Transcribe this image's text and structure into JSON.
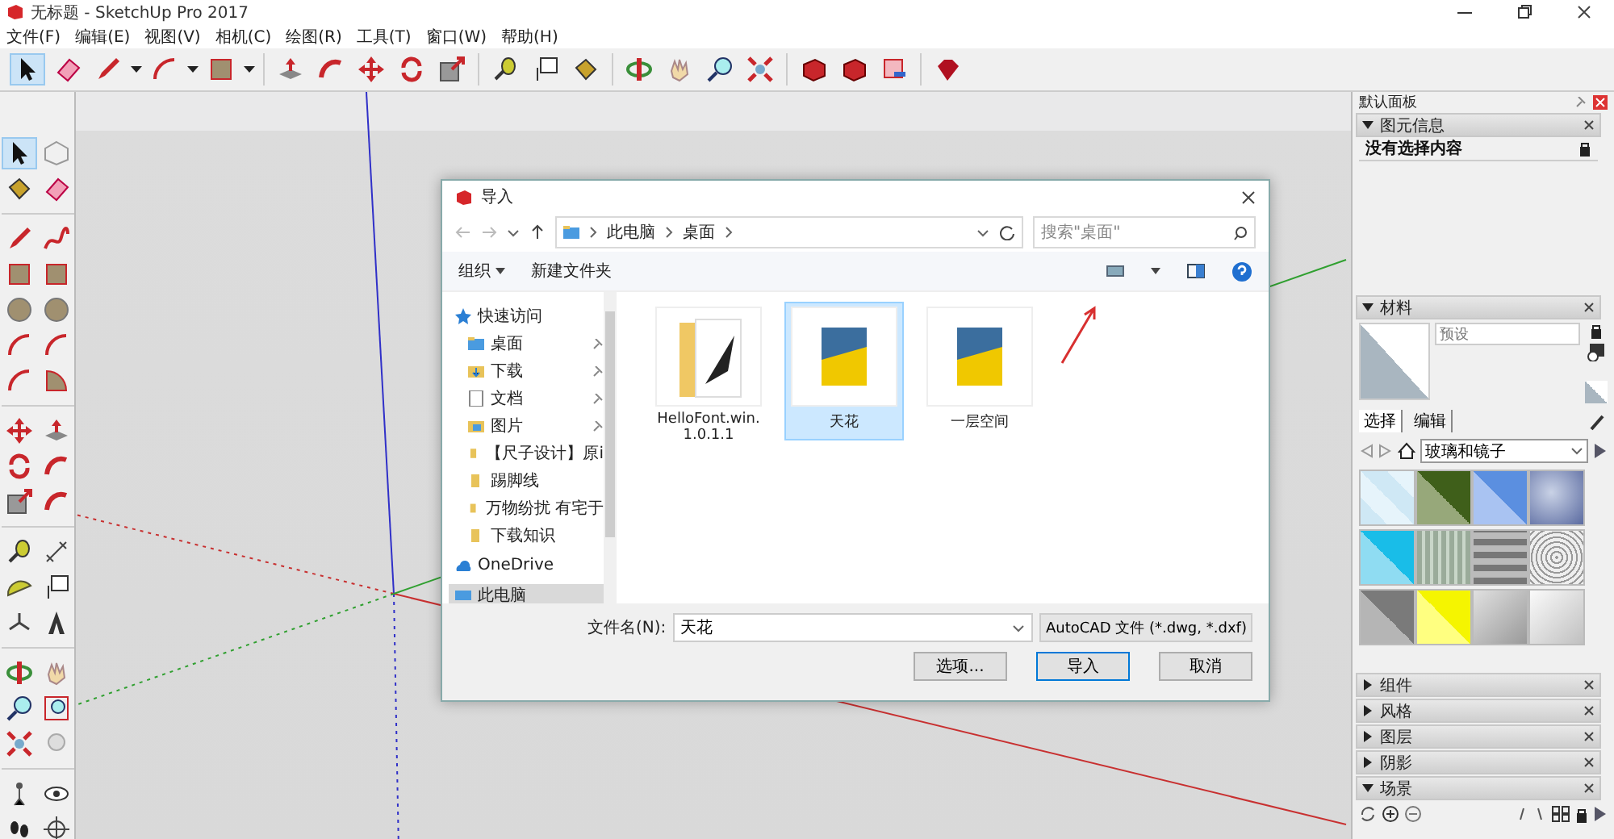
{
  "window": {
    "title": "无标题 - SketchUp Pro 2017"
  },
  "menu": [
    "文件(F)",
    "编辑(E)",
    "视图(V)",
    "相机(C)",
    "绘图(R)",
    "工具(T)",
    "窗口(W)",
    "帮助(H)"
  ],
  "dialog": {
    "title": "导入",
    "breadcrumb": [
      "此电脑",
      "桌面"
    ],
    "search": {
      "placeholder": "搜索\"桌面\""
    },
    "organize": "组织",
    "new_folder": "新建文件夹",
    "nav": [
      {
        "label": "快速访问",
        "kind": "star",
        "selected": false,
        "children": [
          {
            "label": "桌面",
            "kind": "desktop",
            "pinned": true,
            "selected": false
          },
          {
            "label": "下载",
            "kind": "download",
            "pinned": true,
            "selected": false
          },
          {
            "label": "文档",
            "kind": "document",
            "pinned": true,
            "selected": false
          },
          {
            "label": "图片",
            "kind": "picture",
            "pinned": true,
            "selected": false
          },
          {
            "label": "【尺子设计】原i",
            "kind": "folder",
            "pinned": false,
            "selected": false
          },
          {
            "label": "踢脚线",
            "kind": "folder",
            "pinned": false,
            "selected": false
          },
          {
            "label": "万物纷扰 有宅于",
            "kind": "folder",
            "pinned": false,
            "selected": false
          },
          {
            "label": "下载知识",
            "kind": "folder",
            "pinned": false,
            "selected": false
          }
        ]
      },
      {
        "label": "OneDrive",
        "kind": "cloud",
        "selected": false
      },
      {
        "label": "此电脑",
        "kind": "pc",
        "selected": true
      }
    ],
    "files": [
      {
        "name": "HelloFont.win.1.0.1.1",
        "kind": "folder",
        "selected": false
      },
      {
        "name": "天花",
        "kind": "dwg",
        "selected": true
      },
      {
        "name": "一层空间",
        "kind": "dwg",
        "selected": false
      }
    ],
    "filename": {
      "label": "文件名(N):",
      "value": "天花"
    },
    "filetype": "AutoCAD 文件 (*.dwg, *.dxf)",
    "buttons": [
      {
        "label": "选项...",
        "default": false
      },
      {
        "label": "导入",
        "default": true
      },
      {
        "label": "取消",
        "default": false
      }
    ]
  },
  "panel": {
    "title": "默认面板",
    "sections": [
      {
        "title": "图元信息",
        "kind": "entity",
        "expanded": true,
        "content": "没有选择内容"
      },
      {
        "title": "材料",
        "kind": "materials",
        "expanded": true,
        "name_placeholder": "预设",
        "tabs": [
          {
            "label": "选择",
            "selected": true
          },
          {
            "label": "编辑",
            "selected": false
          }
        ],
        "library": "玻璃和镜子"
      },
      {
        "title": "组件",
        "kind": "plain",
        "expanded": false
      },
      {
        "title": "风格",
        "kind": "plain",
        "expanded": false
      },
      {
        "title": "图层",
        "kind": "plain",
        "expanded": false
      },
      {
        "title": "阴影",
        "kind": "plain",
        "expanded": false
      },
      {
        "title": "场景",
        "kind": "scenes",
        "expanded": true
      }
    ]
  }
}
